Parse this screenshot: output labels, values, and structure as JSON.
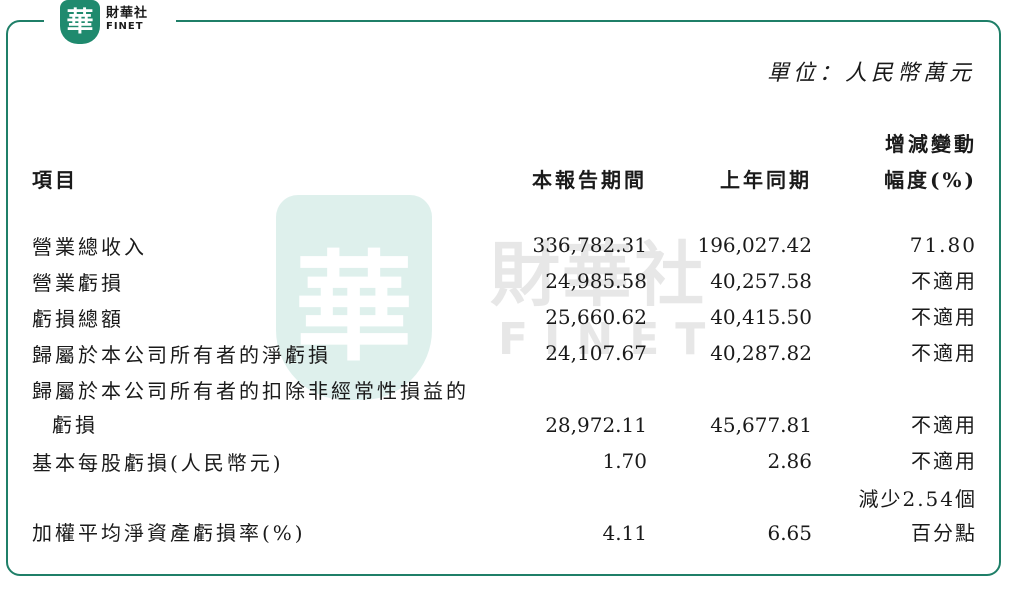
{
  "logo": {
    "badge_char": "華",
    "name_cn": "財華社",
    "name_en": "FINET"
  },
  "watermark": {
    "seal_char": "華",
    "name_cn": "財華社",
    "name_en": "FINET"
  },
  "unit": "單位：人民幣萬元",
  "table": {
    "headers": {
      "item": "項目",
      "current": "本報告期間",
      "previous": "上年同期",
      "change_line1": "增減變動",
      "change_line2": "幅度(%)"
    },
    "rows": [
      {
        "label": "營業總收入",
        "current": "336,782.31",
        "previous": "196,027.42",
        "change": "71.80"
      },
      {
        "label": "營業虧損",
        "current": "24,985.58",
        "previous": "40,257.58",
        "change": "不適用"
      },
      {
        "label": "虧損總額",
        "current": "25,660.62",
        "previous": "40,415.50",
        "change": "不適用"
      },
      {
        "label": "歸屬於本公司所有者的淨虧損",
        "current": "24,107.67",
        "previous": "40,287.82",
        "change": "不適用"
      },
      {
        "label": "歸屬於本公司所有者的扣除非經常性損益的",
        "label_line2": "虧損",
        "current": "28,972.11",
        "previous": "45,677.81",
        "change": "不適用"
      },
      {
        "label": "基本每股虧損(人民幣元)",
        "current": "1.70",
        "previous": "2.86",
        "change": "不適用"
      },
      {
        "label": "加權平均淨資產虧損率(%)",
        "current": "4.11",
        "previous": "6.65",
        "change": "減少2.54個",
        "change_line2": "百分點"
      }
    ]
  }
}
